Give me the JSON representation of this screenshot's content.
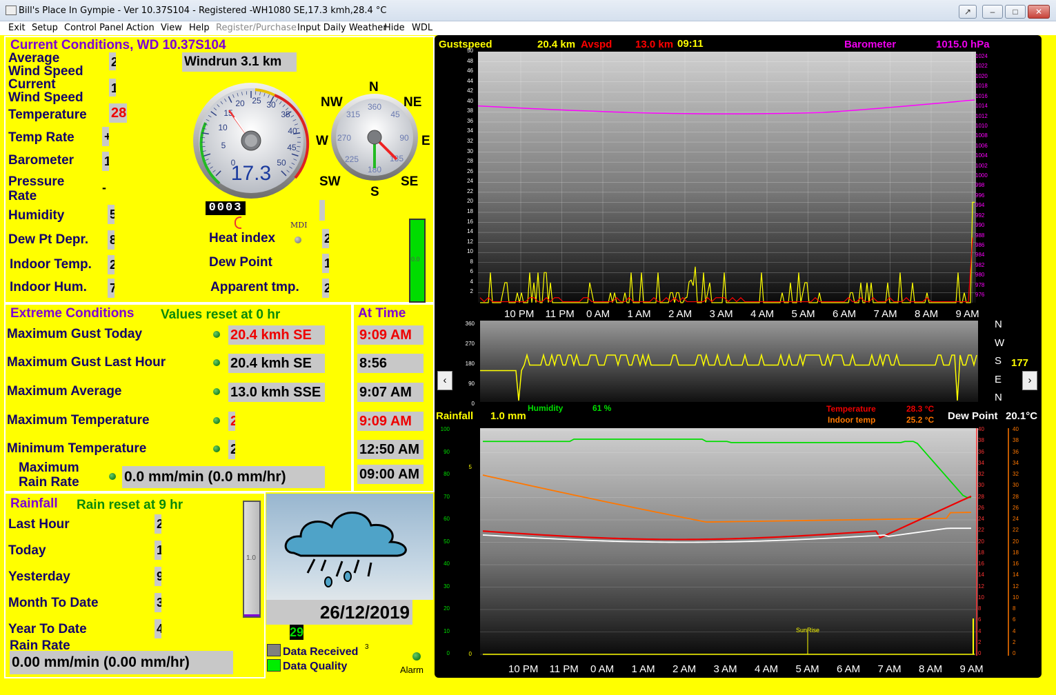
{
  "window": {
    "title": "Bill's Place In Gympie - Ver 10.37S104 - Registered  -WH1080  SE,17.3 kmh,28.4 °C"
  },
  "menu": [
    "Exit",
    "Setup",
    "Control Panel",
    "Action",
    "View",
    "Help",
    "Register/Purchase",
    "Input Daily Weather",
    "Hide",
    "WDL"
  ],
  "current": {
    "title": "Current Conditions, WD 10.37S104",
    "avg_wind_label": "Average\nWind Speed",
    "avg_wind_label1": "Average",
    "avg_wind_label2": "Wind Speed",
    "avg_wind_value": "2",
    "cur_wind_label1": "Current",
    "cur_wind_label2": "Wind Speed",
    "cur_wind_value": "1",
    "windrun": "Windrun 3.1 km",
    "temperature_label": "Temperature",
    "temperature_value": "28",
    "temp_rate_label": "Temp Rate",
    "temp_rate_value": "+",
    "barometer_label": "Barometer",
    "barometer_value": "1",
    "pressure_rate_label1": "Pressure",
    "pressure_rate_label2": "Rate",
    "pressure_rate_value": "-",
    "humidity_label": "Humidity",
    "humidity_value": "5",
    "dewpt_depr_label": "Dew Pt Depr.",
    "dewpt_depr_value": "8",
    "indoor_temp_label": "Indoor Temp.",
    "indoor_temp_value": "2",
    "indoor_hum_label": "Indoor Hum.",
    "indoor_hum_value": "7",
    "heat_index_label": "Heat index",
    "heat_index_value": "2",
    "dew_point_label": "Dew Point",
    "dew_point_value": "1",
    "apparent_label": "Apparent tmp.",
    "apparent_value": "2",
    "mdi": "MDI",
    "speed_gauge": {
      "reading": "17.3",
      "ticks": [
        "0",
        "5",
        "10",
        "15",
        "20",
        "25",
        "30",
        "35",
        "40",
        "45",
        "50"
      ],
      "odometer": "0003"
    },
    "compass": {
      "points": [
        "N",
        "NE",
        "E",
        "SE",
        "S",
        "SW",
        "W",
        "NW"
      ],
      "ticks": [
        "360",
        "45",
        "90",
        "135",
        "180",
        "225",
        "270",
        "315"
      ]
    },
    "green_bar_value": "0.0"
  },
  "extreme": {
    "title": "Extreme Conditions",
    "reset": "Values reset at 0 hr",
    "at_time": "At Time",
    "rows": [
      {
        "label": "Maximum Gust Today",
        "value": "20.4 kmh SE",
        "time": "9:09 AM",
        "red": true
      },
      {
        "label": "Maximum Gust Last Hour",
        "value": "20.4 kmh  SE",
        "time": "8:56",
        "red": false
      },
      {
        "label": "Maximum Average",
        "value": "13.0 kmh SSE",
        "time": "9:07 AM",
        "red": false
      },
      {
        "label": "Maximum Temperature",
        "value": "2",
        "time": "9:09 AM",
        "red": true
      },
      {
        "label": "Minimum Temperature",
        "value": "2",
        "time": "12:50 AM",
        "red": false
      }
    ],
    "max_rain_label1": "Maximum",
    "max_rain_label2": "Rain Rate",
    "max_rain_value": "0.0 mm/min (0.0 mm/hr)",
    "max_rain_time": "09:00 AM"
  },
  "rainfall": {
    "title": "Rainfall",
    "reset": "Rain reset at 9 hr",
    "last_hour_label": "Last Hour",
    "last_hour_value": "2",
    "today_label": "Today",
    "today_value": "1",
    "yesterday_label": "Yesterday",
    "yesterday_value": "9",
    "month_label": "Month To Date",
    "month_value": "3",
    "year_label": "Year To Date",
    "year_value": "4",
    "rain_rate_label": "Rain Rate",
    "rain_rate_value": "0.00 mm/min (0.00 mm/hr)",
    "gauge_value": "1.0"
  },
  "status": {
    "date": "26/12/2019",
    "time_partial": "29",
    "data_received": "Data Received",
    "data_quality": "Data Quality",
    "alarm": "Alarm",
    "small_num": "3"
  },
  "graphs": {
    "top": {
      "gust_label": "Gustspeed",
      "gust_value": "20.4 km",
      "avg_label": "Avspd",
      "avg_value": "13.0 km",
      "time": "09:11",
      "baro_label": "Barometer",
      "baro_value": "1015.0 hPa",
      "left_ticks": [
        "50",
        "48",
        "46",
        "44",
        "42",
        "40",
        "38",
        "36",
        "34",
        "32",
        "30",
        "28",
        "26",
        "24",
        "22",
        "20",
        "18",
        "16",
        "14",
        "12",
        "10",
        "8",
        "6",
        "4",
        "2"
      ],
      "right_ticks": [
        "1024",
        "1022",
        "1020",
        "1018",
        "1016",
        "1014",
        "1012",
        "1010",
        "1008",
        "1006",
        "1004",
        "1002",
        "1000",
        "998",
        "996",
        "994",
        "992",
        "990",
        "988",
        "986",
        "984",
        "982",
        "980",
        "978",
        "976"
      ],
      "x_labels": [
        "10 PM",
        "11 PM",
        "0 AM",
        "1 AM",
        "2 AM",
        "3 AM",
        "4 AM",
        "5 AM",
        "6 AM",
        "7 AM",
        "8 AM",
        "9 AM"
      ]
    },
    "wind_dir": {
      "ticks": [
        "360",
        "270",
        "180",
        "90",
        "0"
      ],
      "dirs": [
        "N",
        "W",
        "S",
        "E",
        "N"
      ],
      "value": "177"
    },
    "bottom": {
      "rainfall_label": "Rainfall",
      "rainfall_value": "1.0 mm",
      "humidity_label": "Humidity",
      "humidity_value": "61 %",
      "temp_label": "Temperature",
      "temp_value": "28.3 °C",
      "indoor_label": "Indoor temp",
      "indoor_value": "25.2 °C",
      "dewpoint_label": "Dew Point",
      "dewpoint_value": "20.1°C",
      "left_ticks": [
        "100",
        "90",
        "80",
        "70",
        "60",
        "50",
        "40",
        "30",
        "20",
        "10",
        "0"
      ],
      "rain_ticks": [
        "5",
        "0"
      ],
      "right_ticks": [
        "40",
        "38",
        "36",
        "34",
        "32",
        "30",
        "28",
        "26",
        "24",
        "22",
        "20",
        "18",
        "16",
        "14",
        "12",
        "10",
        "8",
        "6",
        "4",
        "2",
        "0"
      ],
      "sunrise": "SunRise",
      "x_labels": [
        "10 PM",
        "11 PM",
        "0 AM",
        "1 AM",
        "2 AM",
        "3 AM",
        "4 AM",
        "5 AM",
        "6 AM",
        "7 AM",
        "8 AM",
        "9 AM"
      ]
    }
  },
  "colors": {
    "panel_bg": "#ffff00",
    "gust": "#ffff00",
    "avspd": "#ff0000",
    "baro": "#ff00ff",
    "humidity": "#00dd00",
    "temp": "#ee0000",
    "indoor": "#ff7700",
    "dew": "#ffffff"
  }
}
